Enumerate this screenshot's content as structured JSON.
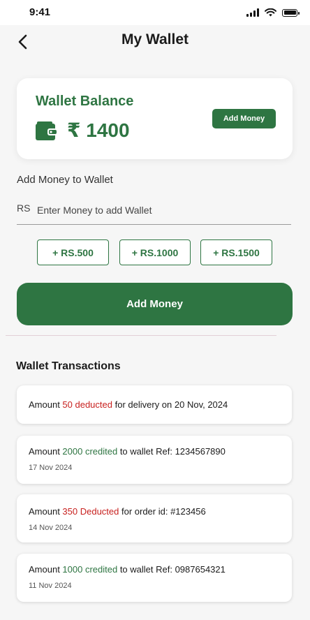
{
  "status_bar": {
    "time": "9:41"
  },
  "header": {
    "title": "My Wallet"
  },
  "balance_card": {
    "label": "Wallet Balance",
    "amount": "₹ 1400",
    "add_button": "Add Money"
  },
  "add_section": {
    "label": "Add Money to Wallet",
    "currency_prefix": "RS",
    "placeholder": "Enter Money to add Wallet",
    "chips": [
      "+ RS.500",
      "+ RS.1000",
      "+ RS.1500"
    ],
    "submit_button": "Add Money"
  },
  "transactions": {
    "title": "Wallet Transactions",
    "items": [
      {
        "prefix": "Amount ",
        "highlight": "50 deducted",
        "status": "debit",
        "suffix": " for delivery on 20 Nov, 2024",
        "date": ""
      },
      {
        "prefix": "Amount ",
        "highlight": "2000 credited",
        "status": "credit",
        "suffix": " to wallet Ref: 1234567890",
        "date": "17 Nov 2024"
      },
      {
        "prefix": "Amount ",
        "highlight": "350 Deducted",
        "status": "debit",
        "suffix": " for order id: #123456",
        "date": "14 Nov 2024"
      },
      {
        "prefix": "Amount ",
        "highlight": "1000 credited",
        "status": "credit",
        "suffix": " to wallet Ref: 0987654321",
        "date": "11 Nov 2024"
      }
    ]
  },
  "colors": {
    "brand_green": "#2e7542",
    "debit_red": "#c8211f",
    "background": "#f6f6f6"
  },
  "icons": [
    "back-arrow-icon",
    "wallet-icon",
    "signal-icon",
    "wifi-icon",
    "battery-icon"
  ]
}
